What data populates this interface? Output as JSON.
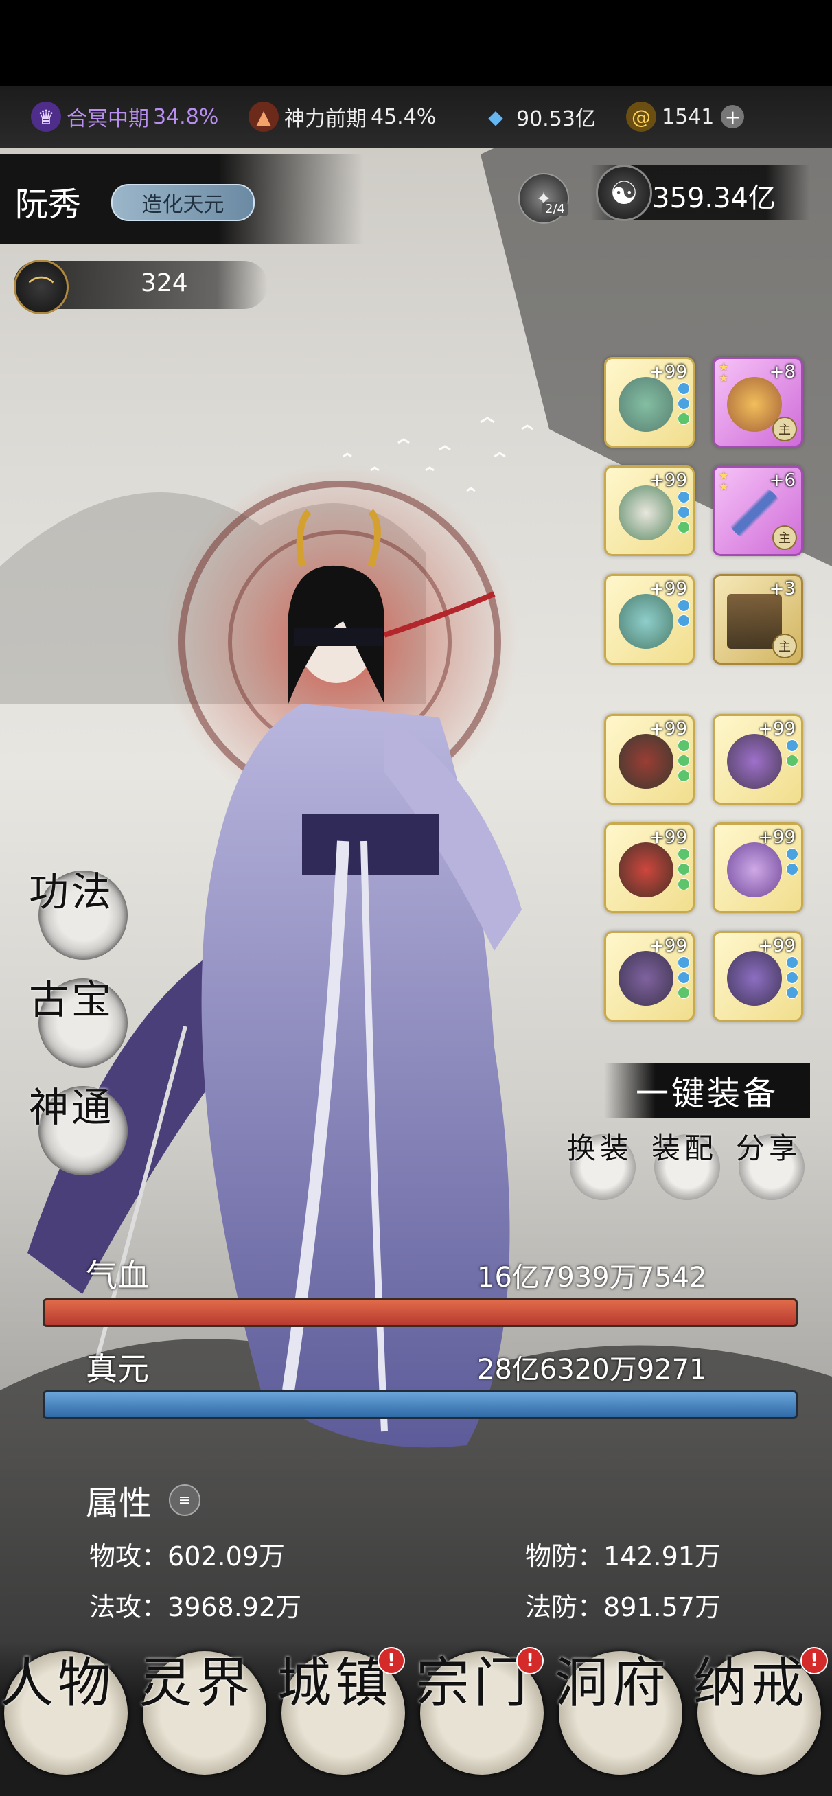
{
  "resources": {
    "realm_name": "合冥中期",
    "realm_pct": "34.8%",
    "divine_name": "神力前期",
    "divine_pct": "45.4%",
    "spirit_stone": "90.53亿",
    "gold": "1541"
  },
  "character": {
    "name": "阮秀",
    "title": "造化天元",
    "spirit_count": "2/4",
    "yinyang_value": "359.34亿",
    "power_value": "324"
  },
  "equipment": {
    "top": [
      {
        "level": "+99"
      },
      {
        "level": "+8",
        "tag": "主"
      },
      {
        "level": "+99"
      },
      {
        "level": "+6",
        "tag": "主"
      },
      {
        "level": "+99"
      },
      {
        "level": "+3",
        "tag": "主"
      }
    ],
    "bottom": [
      {
        "level": "+99"
      },
      {
        "level": "+99"
      },
      {
        "level": "+99"
      },
      {
        "level": "+99"
      },
      {
        "level": "+99"
      },
      {
        "level": "+99"
      }
    ]
  },
  "side_menu": {
    "skills": "功法",
    "treasures": "古宝",
    "powers": "神通"
  },
  "actions": {
    "equip_all": "一键装备",
    "swap": "换装",
    "assemble": "装配",
    "share": "分享"
  },
  "stats": {
    "hp_label": "气血",
    "hp_value": "16亿7939万7542",
    "mp_label": "真元",
    "mp_value": "28亿6320万9271",
    "attr_title": "属性",
    "phys_atk_label": "物攻：",
    "phys_atk": "602.09万",
    "phys_def_label": "物防：",
    "phys_def": "142.91万",
    "mag_atk_label": "法攻：",
    "mag_atk": "3968.92万",
    "mag_def_label": "法防：",
    "mag_def": "891.57万"
  },
  "nav": [
    {
      "label": "人物",
      "badge": ""
    },
    {
      "label": "灵界",
      "badge": ""
    },
    {
      "label": "城镇",
      "badge": "!"
    },
    {
      "label": "宗门",
      "badge": "!"
    },
    {
      "label": "洞府",
      "badge": ""
    },
    {
      "label": "纳戒",
      "badge": "!"
    }
  ]
}
